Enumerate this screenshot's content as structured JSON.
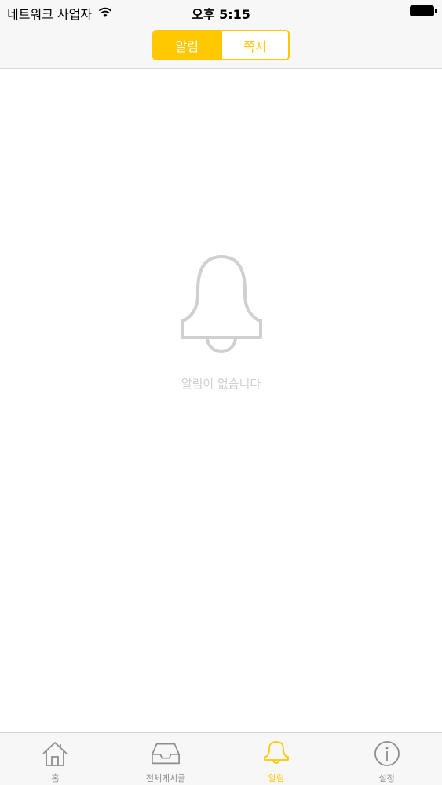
{
  "status_bar": {
    "carrier": "네트워크 사업자",
    "time": "오후 5:15"
  },
  "nav": {
    "segments": [
      {
        "label": "알림",
        "active": true
      },
      {
        "label": "쪽지",
        "active": false
      }
    ]
  },
  "empty_state": {
    "icon": "bell-icon",
    "message": "알림이 없습니다"
  },
  "tab_bar": {
    "tabs": [
      {
        "label": "홈",
        "icon": "home-icon",
        "active": false
      },
      {
        "label": "전체게시글",
        "icon": "inbox-icon",
        "active": false
      },
      {
        "label": "알림",
        "icon": "bell-icon",
        "active": true
      },
      {
        "label": "설정",
        "icon": "info-icon",
        "active": false
      }
    ]
  },
  "colors": {
    "accent": "#ffc800",
    "inactive_tab": "#8e8e8e",
    "empty_icon": "#d0d0d0"
  }
}
